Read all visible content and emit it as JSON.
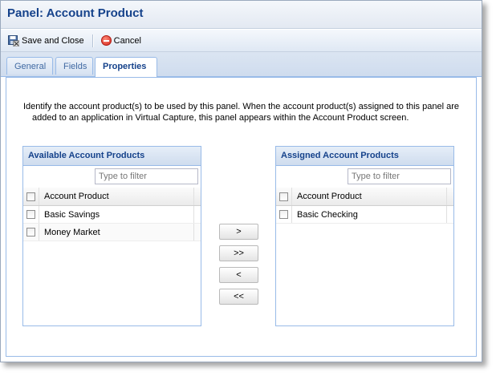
{
  "window": {
    "title": "Panel: Account Product"
  },
  "toolbar": {
    "save_label": "Save and Close",
    "cancel_label": "Cancel"
  },
  "tabs": [
    {
      "label": "General",
      "active": false
    },
    {
      "label": "Fields",
      "active": false
    },
    {
      "label": "Properties",
      "active": true
    }
  ],
  "description": {
    "line1": "Identify the account product(s) to be used by this panel. When the account product(s) assigned to this panel are",
    "line2": "added to an application in Virtual Capture, this panel appears within the Account Product screen."
  },
  "available": {
    "title": "Available Account Products",
    "filter_placeholder": "Type to filter",
    "column_header": "Account Product",
    "rows": [
      "Basic Savings",
      "Money Market"
    ]
  },
  "assigned": {
    "title": "Assigned Account Products",
    "filter_placeholder": "Type to filter",
    "column_header": "Account Product",
    "rows": [
      "Basic Checking"
    ]
  },
  "move_buttons": {
    "add": ">",
    "add_all": ">>",
    "remove": "<",
    "remove_all": "<<"
  },
  "colors": {
    "header_text": "#15428b",
    "border": "#99bbe8",
    "cancel_icon": "#d2231a"
  },
  "icons": {
    "save": "save-close-icon",
    "cancel": "cancel-icon"
  }
}
